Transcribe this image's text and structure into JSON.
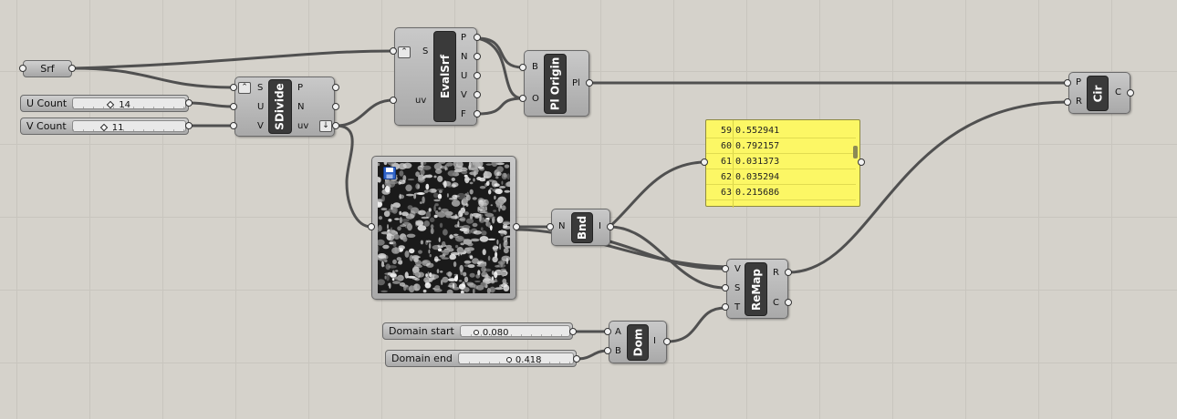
{
  "srf": {
    "label": "Srf"
  },
  "sliders": {
    "u_count": {
      "name": "U Count",
      "value": "14"
    },
    "v_count": {
      "name": "V Count",
      "value": "11"
    },
    "domain_start": {
      "name": "Domain start",
      "value": "0.080"
    },
    "domain_end": {
      "name": "Domain end",
      "value": "0.418"
    }
  },
  "sdivide": {
    "title": "SDivide",
    "inputs": [
      "S",
      "U",
      "V"
    ],
    "outputs": [
      "P",
      "N",
      "uv"
    ]
  },
  "evalsrf": {
    "title": "EvalSrf",
    "inputs": [
      "S",
      "uv"
    ],
    "outputs": [
      "P",
      "N",
      "U",
      "V",
      "F"
    ]
  },
  "plorigin": {
    "title": "Pl Origin",
    "inputs": [
      "B",
      "O"
    ],
    "outputs": [
      "Pl"
    ]
  },
  "cir": {
    "title": "Cir",
    "inputs": [
      "P",
      "R"
    ],
    "outputs": [
      "C"
    ]
  },
  "bnd": {
    "title": "Bnd",
    "inputs": [
      "N"
    ],
    "outputs": [
      "I"
    ]
  },
  "remap": {
    "title": "ReMap",
    "inputs": [
      "V",
      "S",
      "T"
    ],
    "outputs": [
      "R",
      "C"
    ]
  },
  "dom": {
    "title": "Dom",
    "inputs": [
      "A",
      "B"
    ],
    "outputs": [
      "I"
    ]
  },
  "panel": {
    "rows": [
      {
        "idx": "59",
        "val": "0.552941"
      },
      {
        "idx": "60",
        "val": "0.792157"
      },
      {
        "idx": "61",
        "val": "0.031373"
      },
      {
        "idx": "62",
        "val": "0.035294"
      },
      {
        "idx": "63",
        "val": "0.215686"
      }
    ]
  },
  "icons": {
    "image_sampler": "image-sampler-noise",
    "save": "floppy-disk-icon",
    "zoom_toggle": "chevron-up-icon",
    "flatten": "down-arrow-icon"
  },
  "colors": {
    "canvas": "#d5d2cb",
    "wire": "#555555",
    "component": "#b5b5b5",
    "panel": "#fcf765"
  }
}
